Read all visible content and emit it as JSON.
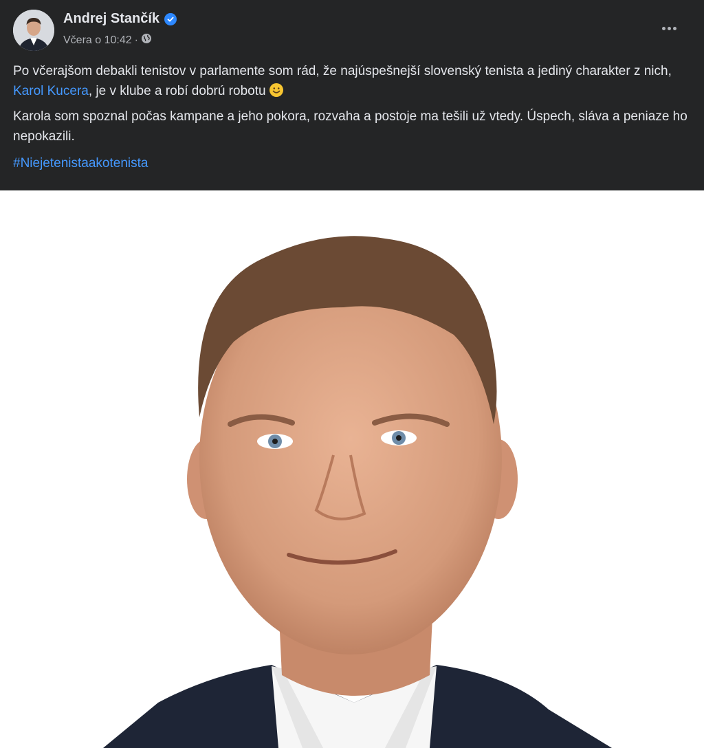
{
  "post": {
    "author": "Andrej Stančík",
    "timestamp": "Včera o 10:42",
    "separator": "·",
    "paragraph1": {
      "before": "Po včerajšom debakli tenistov v parlamente som rád, že najúspešnejší slovenský tenista a jediný charakter z nich, ",
      "link": "Karol Kucera",
      "after": ", je v klube a robí dobrú robotu"
    },
    "paragraph2": "Karola som spoznal počas kampane a jeho pokora, rozvaha a postoje ma tešili už vtedy. Úspech, sláva a peniaze ho nepokazili.",
    "hashtag": "#Niejetenistaakotenista"
  },
  "icons": {
    "verified": "verified-badge-icon",
    "audience": "globe-icon",
    "more": "more-options-icon",
    "emoji": "smiling-face-emoji"
  },
  "colors": {
    "background": "#242526",
    "text": "#e4e6eb",
    "secondary_text": "#b0b3b8",
    "link": "#4599ff",
    "verified": "#2d88ff"
  }
}
